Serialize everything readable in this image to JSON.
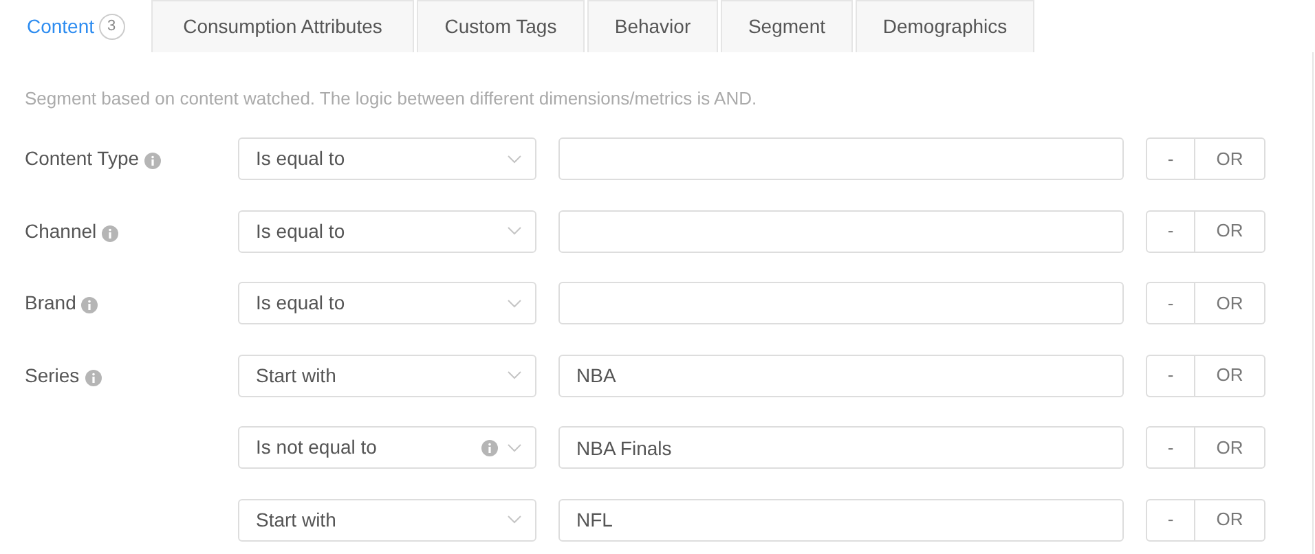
{
  "tabs": [
    {
      "label": "Content",
      "count": "3",
      "selected": true
    },
    {
      "label": "Consumption Attributes",
      "selected": false
    },
    {
      "label": "Custom Tags",
      "selected": false
    },
    {
      "label": "Behavior",
      "selected": false
    },
    {
      "label": "Segment",
      "selected": false
    },
    {
      "label": "Demographics",
      "selected": false
    }
  ],
  "description": "Segment based on content watched. The logic between different dimensions/metrics is AND.",
  "fields": [
    {
      "label": "Content Type",
      "conditions": [
        {
          "operator": "Is equal to",
          "info": false,
          "remove": "-",
          "or": "OR"
        }
      ]
    },
    {
      "label": "Channel",
      "conditions": [
        {
          "operator": "Is equal to",
          "info": false,
          "remove": "-",
          "or": "OR"
        }
      ]
    },
    {
      "label": "Brand",
      "conditions": [
        {
          "operator": "Is equal to",
          "info": false,
          "remove": "-",
          "or": "OR"
        }
      ]
    },
    {
      "label": "Series",
      "conditions": [
        {
          "operator": "Start with",
          "value": "NBA",
          "info": false,
          "remove": "-",
          "or": "OR"
        },
        {
          "operator": "Is not equal to",
          "value": "NBA Finals",
          "info": true,
          "remove": "-",
          "or": "OR"
        },
        {
          "operator": "Start with",
          "value": "NFL",
          "info": false,
          "remove": "-",
          "or": "OR"
        }
      ]
    }
  ]
}
